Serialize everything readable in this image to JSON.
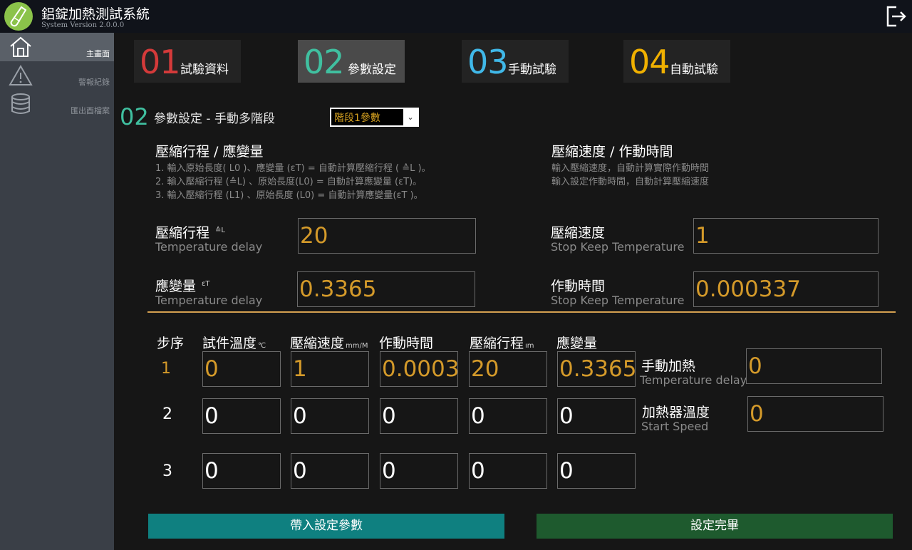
{
  "app": {
    "title": "鋁錠加熱測試系統",
    "version": "System Version 2.0.0.0"
  },
  "sidebar": {
    "items": [
      {
        "label": "主畫面",
        "icon": "home-icon",
        "active": true
      },
      {
        "label": "警報紀錄",
        "icon": "warning-icon",
        "active": false
      },
      {
        "label": "匯出酉檔案",
        "icon": "database-icon",
        "active": false
      }
    ]
  },
  "steps": [
    {
      "num": "01",
      "label": "試驗資料",
      "color": "#d43a3a"
    },
    {
      "num": "02",
      "label": "參數設定",
      "color": "#40c0a0"
    },
    {
      "num": "03",
      "label": "手動試驗",
      "color": "#40b8e8"
    },
    {
      "num": "04",
      "label": "自動試驗",
      "color": "#f0b000"
    }
  ],
  "section": {
    "num": "02",
    "title": "參數設定 - 手動多階段",
    "stage_select": "階段1參數"
  },
  "left_panel": {
    "heading": "壓縮行程 / 應變量",
    "notes": [
      "1. 輸入原始長度( L0 )、應變量 (εT)     =  自動計算壓縮行程 ( ≙L )。",
      "2. 輸入壓縮行程 (≙L) 、原始長度(L0)  = 自動計算應變量 (εT)。",
      "3. 輸入壓縮行程 (L1) 、原始長度 (L0) = 自動計算應變量(εT )。"
    ],
    "stroke": {
      "label": "壓縮行程",
      "unit": "≙L",
      "sub": "Temperature delay",
      "value": "20"
    },
    "strain": {
      "label": "應變量",
      "unit": "εT",
      "sub": "Temperature delay",
      "value": "0.3365"
    }
  },
  "right_panel": {
    "heading": "壓縮速度 / 作動時間",
    "notes": [
      "輸入壓縮速度，自動計算實際作動時間",
      "輸入設定作動時間，自動計算壓縮速度"
    ],
    "speed": {
      "label": "壓縮速度",
      "sub": "Stop Keep Temperature",
      "value": "1"
    },
    "time": {
      "label": "作動時間",
      "sub": "Stop Keep Temperature",
      "value": "0.000337"
    }
  },
  "table": {
    "headers": [
      {
        "label": "步序",
        "unit": ""
      },
      {
        "label": "試件溫度",
        "unit": "℃"
      },
      {
        "label": "壓縮速度",
        "unit": "mm/M"
      },
      {
        "label": "作動時間",
        "unit": ""
      },
      {
        "label": "壓縮行程",
        "unit": "ım"
      },
      {
        "label": "應變量",
        "unit": ""
      }
    ],
    "rows": [
      {
        "step": "1",
        "values": [
          "0",
          "1",
          "0.0003.",
          "20",
          "0.3365"
        ]
      },
      {
        "step": "2",
        "values": [
          "0",
          "0",
          "0",
          "0",
          "0"
        ]
      },
      {
        "step": "3",
        "values": [
          "0",
          "0",
          "0",
          "0",
          "0"
        ]
      }
    ]
  },
  "side_fields": {
    "manual_heat": {
      "label": "手動加熱",
      "sub": "Temperature delay",
      "value": "0"
    },
    "heater_temp": {
      "label": "加熱器溫度",
      "sub": "Start Speed",
      "value": "0"
    }
  },
  "buttons": {
    "load_params": "帶入設定參數",
    "finish": "設定完畢"
  },
  "colors": {
    "value": "#d49a2a",
    "separator": "#d4a050",
    "load_button": "#0f8080",
    "finish_button": "#1e5a2e"
  }
}
